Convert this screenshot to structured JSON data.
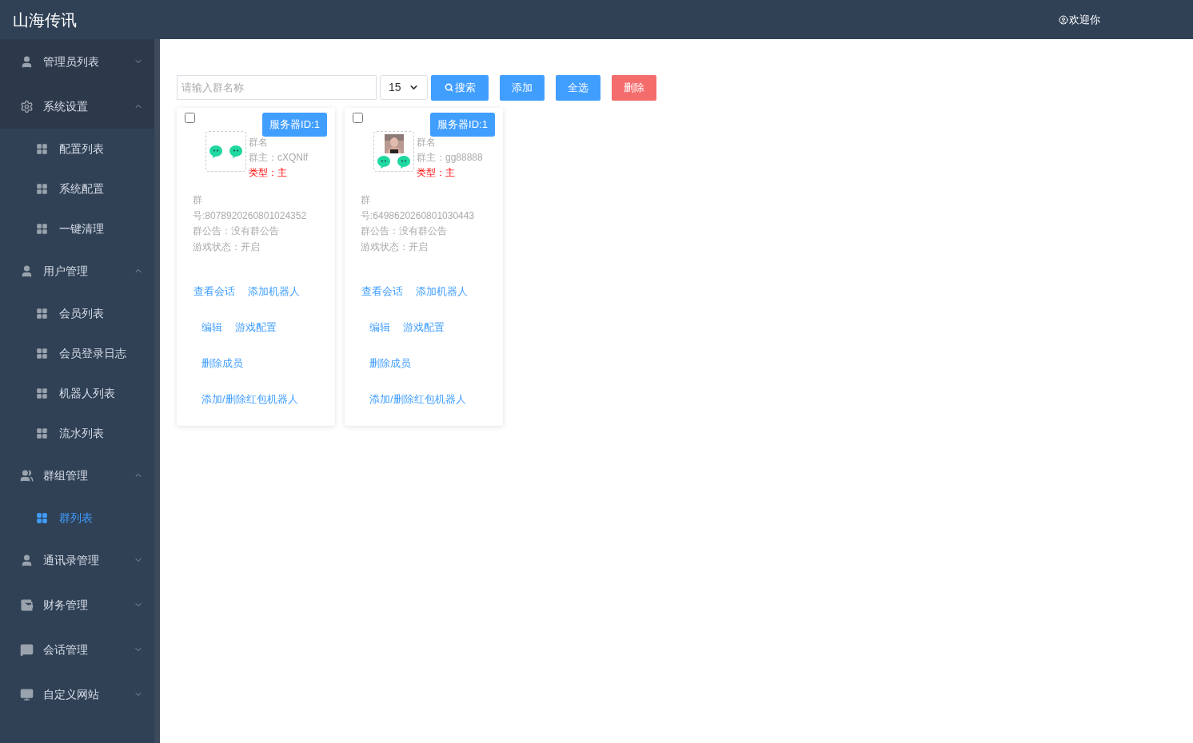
{
  "header": {
    "title": "山海传讯",
    "welcome": "欢迎你"
  },
  "sidebar": {
    "items": [
      {
        "label": "管理员列表",
        "expanded": false
      },
      {
        "label": "系统设置",
        "expanded": true,
        "children": [
          {
            "label": "配置列表",
            "selected": false
          },
          {
            "label": "系统配置",
            "selected": false
          },
          {
            "label": "一键清理",
            "selected": false
          }
        ]
      },
      {
        "label": "用户管理",
        "expanded": true,
        "children": [
          {
            "label": "会员列表",
            "selected": false
          },
          {
            "label": "会员登录日志",
            "selected": false
          },
          {
            "label": "机器人列表",
            "selected": false
          },
          {
            "label": "流水列表",
            "selected": false
          }
        ]
      },
      {
        "label": "群组管理",
        "expanded": true,
        "children": [
          {
            "label": "群列表",
            "selected": true
          }
        ]
      },
      {
        "label": "通讯录管理",
        "expanded": false
      },
      {
        "label": "财务管理",
        "expanded": false
      },
      {
        "label": "会话管理",
        "expanded": false
      },
      {
        "label": "自定义网站",
        "expanded": false
      }
    ]
  },
  "toolbar": {
    "search": {
      "placeholder": "请输入群名称"
    },
    "page_size": "15",
    "buttons": [
      {
        "label": "搜索",
        "kind": "search"
      },
      {
        "label": "添加",
        "kind": "primary"
      },
      {
        "label": "全选",
        "kind": "primary"
      },
      {
        "label": "删除",
        "kind": "danger"
      }
    ]
  },
  "cards": [
    {
      "checked": false,
      "badge": "服务器ID:1",
      "has_photo": false,
      "name": "群名",
      "owner": "群主：cXQNlf",
      "type": "类型：主",
      "number_label": "群",
      "number": "号:8078920260801024352",
      "notice": "群公告：没有群公告",
      "game_status": "游戏状态：开启",
      "actions": [
        [
          "查看会话",
          "添加机器人"
        ],
        [
          "编辑",
          "游戏配置"
        ],
        [
          "删除成员"
        ],
        [
          "添加/删除红包机器人"
        ]
      ]
    },
    {
      "checked": false,
      "badge": "服务器ID:1",
      "has_photo": true,
      "name": "群名",
      "owner": "群主：gg88888",
      "type": "类型：主",
      "number_label": "群",
      "number": "号:6498620260801030443",
      "notice": "群公告：没有群公告",
      "game_status": "游戏状态：开启",
      "actions": [
        [
          "查看会话",
          "添加机器人"
        ],
        [
          "编辑",
          "游戏配置"
        ],
        [
          "删除成员"
        ],
        [
          "添加/删除红包机器人"
        ]
      ]
    }
  ]
}
